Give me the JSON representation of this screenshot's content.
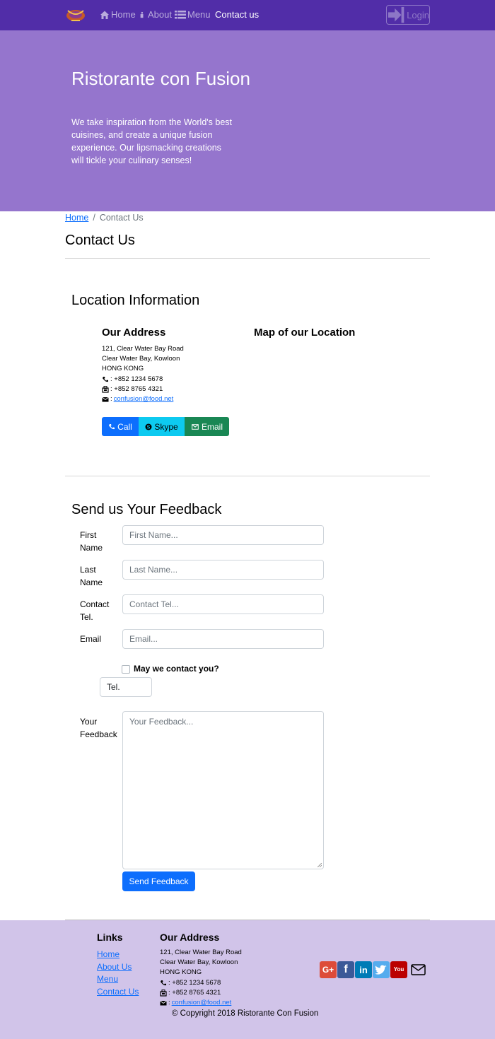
{
  "navbar": {
    "items": [
      {
        "label": "Home",
        "icon": "home-icon"
      },
      {
        "label": "About",
        "icon": "info-icon"
      },
      {
        "label": "Menu",
        "icon": "list-icon"
      },
      {
        "label": "Contact us",
        "icon": ""
      }
    ],
    "active": "Contact us",
    "login_label": "Login",
    "brand_color": "#512da8"
  },
  "jumbotron": {
    "title": "Ristorante con Fusion",
    "text": "We take inspiration from the World's best cuisines, and create a unique fusion experience. Our lipsmacking creations will tickle your culinary senses!",
    "bg_color": "#9575cd"
  },
  "breadcrumb": {
    "home": "Home",
    "separator": "/",
    "current": "Contact Us"
  },
  "page_title": "Contact Us",
  "location": {
    "title": "Location Information",
    "address_title": "Our Address",
    "map_title": "Map of our Location",
    "address_lines": [
      "121, Clear Water Bay Road",
      "Clear Water Bay, Kowloon",
      "HONG KONG"
    ],
    "phone": ": +852 1234 5678",
    "fax": ": +852 8765 4321",
    "email_prefix": ":",
    "email": "confusion@food.net",
    "buttons": {
      "call": "Call",
      "skype": "Skype",
      "email": "Email"
    }
  },
  "feedback": {
    "title": "Send us Your Feedback",
    "fields": {
      "first_name": {
        "label": "First Name",
        "placeholder": "First Name..."
      },
      "last_name": {
        "label": "Last Name",
        "placeholder": "Last Name..."
      },
      "tel": {
        "label": "Contact Tel.",
        "placeholder": "Contact Tel..."
      },
      "email": {
        "label": "Email",
        "placeholder": "Email..."
      }
    },
    "contact_check_label": "May we contact you?",
    "contact_method": "Tel.",
    "feedback_label": "Your Feedback",
    "feedback_placeholder": "Your Feedback...",
    "submit_label": "Send Feedback"
  },
  "footer": {
    "links_title": "Links",
    "links": [
      "Home",
      "About Us",
      "Menu",
      "Contact Us"
    ],
    "address_title": "Our Address",
    "address_lines": [
      "121, Clear Water Bay Road",
      "Clear Water Bay, Kowloon",
      "HONG KONG"
    ],
    "phone": ": +852 1234 5678",
    "fax": ": +852 8765 4321",
    "email_prefix": ":",
    "email": "confusion@food.net",
    "social": [
      {
        "name": "google-plus-icon",
        "glyph": "G+",
        "color": "#dd4b39"
      },
      {
        "name": "facebook-icon",
        "glyph": "f",
        "color": "#3b5998"
      },
      {
        "name": "linkedin-icon",
        "glyph": "in",
        "color": "#007bb6"
      },
      {
        "name": "twitter-icon",
        "glyph": "t",
        "color": "#55acee"
      },
      {
        "name": "youtube-icon",
        "glyph": "You",
        "color": "#bb0000"
      }
    ],
    "copyright": "© Copyright 2018 Ristorante Con Fusion",
    "bg_color": "#d1c4e9"
  }
}
